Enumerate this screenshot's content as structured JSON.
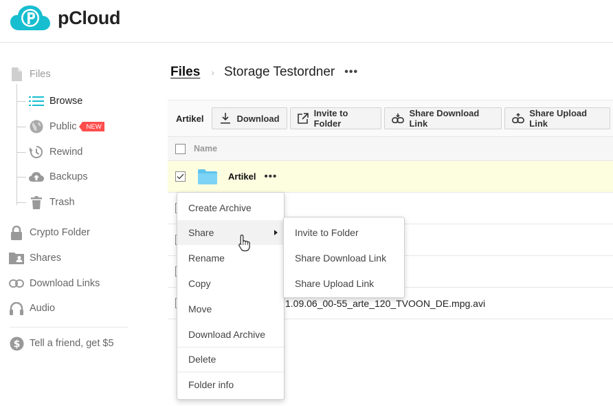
{
  "header": {
    "brand": "pCloud",
    "logo_icon": "pcloud-logo-icon",
    "accent": "#17bed0"
  },
  "sidebar": {
    "items": [
      {
        "label": "Files",
        "icon": "file-icon"
      },
      {
        "label": "Browse",
        "icon": "list-icon",
        "active": true
      },
      {
        "label": "Public",
        "icon": "globe-icon",
        "badge": "NEW"
      },
      {
        "label": "Rewind",
        "icon": "history-icon"
      },
      {
        "label": "Backups",
        "icon": "cloud-upload-icon"
      },
      {
        "label": "Trash",
        "icon": "trash-icon"
      },
      {
        "label": "Crypto Folder",
        "icon": "lock-icon"
      },
      {
        "label": "Shares",
        "icon": "shared-folder-icon"
      },
      {
        "label": "Download Links",
        "icon": "link-icon"
      },
      {
        "label": "Audio",
        "icon": "headphones-icon"
      },
      {
        "label": "Tell a friend, get $5",
        "icon": "dollar-icon"
      }
    ]
  },
  "breadcrumb": {
    "root": "Files",
    "separator": "›",
    "current": "Storage Testordner",
    "more": "•••"
  },
  "toolbar": {
    "selected": "Artikel",
    "buttons": [
      {
        "label": "Download",
        "icon": "download-icon"
      },
      {
        "label": "Invite to Folder",
        "icon": "external-share-icon"
      },
      {
        "label": "Share Download Link",
        "icon": "link-down-icon"
      },
      {
        "label": "Share Upload Link",
        "icon": "link-up-icon"
      }
    ]
  },
  "list": {
    "header_name": "Name",
    "rows": [
      {
        "name": "Artikel",
        "more": "•••",
        "selected": true
      },
      {
        "name": ""
      },
      {
        "name": ""
      },
      {
        "name": ""
      },
      {
        "name": "1.09.06_00-55_arte_120_TVOON_DE.mpg.avi"
      }
    ]
  },
  "context_menu": {
    "items": [
      {
        "label": "Create Archive"
      },
      {
        "label": "Share",
        "submenu": true,
        "hover": true
      },
      {
        "label": "Rename"
      },
      {
        "label": "Copy"
      },
      {
        "label": "Move"
      },
      {
        "label": "Download Archive"
      },
      {
        "label": "Delete"
      },
      {
        "label": "Folder info"
      }
    ],
    "submenu": [
      {
        "label": "Invite to Folder"
      },
      {
        "label": "Share Download Link"
      },
      {
        "label": "Share Upload Link"
      }
    ]
  }
}
